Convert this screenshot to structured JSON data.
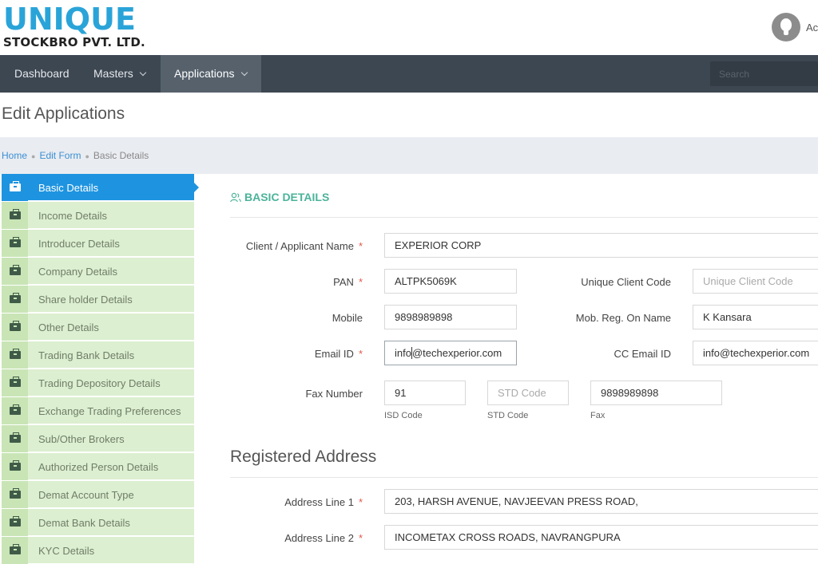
{
  "brand": {
    "name": "UNIQUE",
    "tagline": "STOCKBRO PVT. LTD."
  },
  "user": {
    "name_fragment": "Ac"
  },
  "nav": {
    "items": [
      {
        "label": "Dashboard"
      },
      {
        "label": "Masters"
      },
      {
        "label": "Applications"
      }
    ],
    "active": "Applications",
    "search_placeholder": "Search"
  },
  "page": {
    "title": "Edit Applications"
  },
  "breadcrumb": {
    "home": "Home",
    "edit_form": "Edit Form",
    "current": "Basic Details"
  },
  "sidebar": {
    "items": [
      {
        "label": "Basic Details"
      },
      {
        "label": "Income Details"
      },
      {
        "label": "Introducer Details"
      },
      {
        "label": "Company Details"
      },
      {
        "label": "Share holder Details"
      },
      {
        "label": "Other Details"
      },
      {
        "label": "Trading Bank Details"
      },
      {
        "label": "Trading Depository Details"
      },
      {
        "label": "Exchange Trading Preferences"
      },
      {
        "label": "Sub/Other Brokers"
      },
      {
        "label": "Authorized Person Details"
      },
      {
        "label": "Demat Account Type"
      },
      {
        "label": "Demat Bank Details"
      },
      {
        "label": "KYC Details"
      }
    ],
    "active": "Basic Details"
  },
  "form": {
    "section_title": "BASIC DETAILS",
    "client_name": {
      "label": "Client / Applicant Name",
      "required_mark": "*",
      "value": "EXPERIOR CORP"
    },
    "pan": {
      "label": "PAN",
      "required_mark": "*",
      "value": "ALTPK5069K"
    },
    "unique_client_code": {
      "label": "Unique Client Code",
      "placeholder": "Unique Client Code"
    },
    "mobile": {
      "label": "Mobile",
      "value": "9898989898"
    },
    "mob_reg_name": {
      "label": "Mob. Reg. On Name",
      "value": "K Kansara"
    },
    "email": {
      "label": "Email ID",
      "required_mark": "*",
      "value_before_cursor": "info",
      "value_after_cursor": "@techexperior.com"
    },
    "cc_email": {
      "label": "CC Email ID",
      "value": "info@techexperior.com"
    },
    "fax": {
      "label": "Fax Number",
      "isd": {
        "value": "91",
        "caption": "ISD Code"
      },
      "std": {
        "placeholder": "STD Code",
        "caption": "STD Code"
      },
      "fax": {
        "value": "9898989898",
        "caption": "Fax"
      }
    }
  },
  "address": {
    "section_title": "Registered Address",
    "line1": {
      "label": "Address Line 1",
      "required_mark": "*",
      "value": "203, HARSH AVENUE, NAVJEEVAN PRESS ROAD,"
    },
    "line2": {
      "label": "Address Line 2",
      "required_mark": "*",
      "value": "INCOMETAX CROSS ROADS, NAVRANGPURA"
    }
  },
  "colors": {
    "brand_blue": "#2aa4d8",
    "nav_bg": "#3d4752",
    "sidebar_active": "#1e94e0",
    "sidebar_bg": "#dcefd0",
    "section_green": "#4bb39a",
    "required_red": "#e0584a"
  }
}
